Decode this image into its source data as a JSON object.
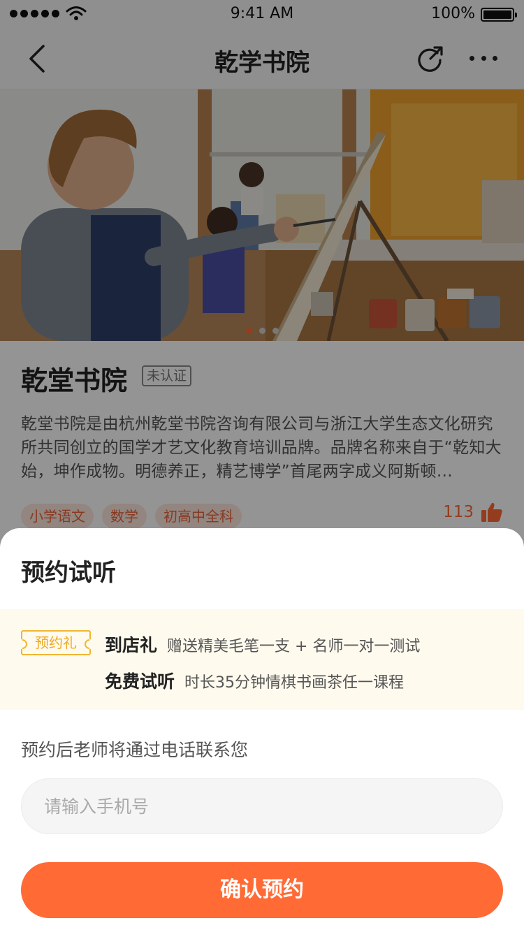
{
  "status_bar": {
    "time": "9:41 AM",
    "battery": "100%"
  },
  "nav": {
    "title": "乾学书院"
  },
  "hero": {
    "slide_count": 3,
    "active_index": 0
  },
  "school": {
    "name": "乾堂书院",
    "cert_badge": "未认证",
    "description": "乾堂书院是由杭州乾堂书院咨询有限公司与浙江大学生态文化研究所共同创立的国学才艺文化教育培训品牌。品牌名称来自于“乾知大始，坤作成物。明德养正，精艺博学”首尾两字成义阿斯顿…",
    "tags": [
      "小学语文",
      "数学",
      "初高中全科"
    ],
    "likes": "113"
  },
  "sheet": {
    "title": "预约试听",
    "gift_badge": "预约礼",
    "gifts": [
      {
        "label": "到店礼",
        "text": "赠送精美毛笔一支 + 名师一对一测试"
      },
      {
        "label": "免费试听",
        "text": "时长35分钟情棋书画茶任一课程"
      }
    ],
    "hint": "预约后老师将通过电话联系您",
    "phone_placeholder": "请输入手机号",
    "phone_value": "",
    "confirm_label": "确认预约"
  },
  "colors": {
    "accent": "#ff6a35",
    "gift_yellow": "#f0b632",
    "gift_bg": "#fffaee",
    "overlay": "rgba(0,0,0,0.42)"
  },
  "icons": [
    "back-icon",
    "share-icon",
    "more-icon",
    "thumbs-up-icon",
    "wifi-icon",
    "battery-icon"
  ]
}
